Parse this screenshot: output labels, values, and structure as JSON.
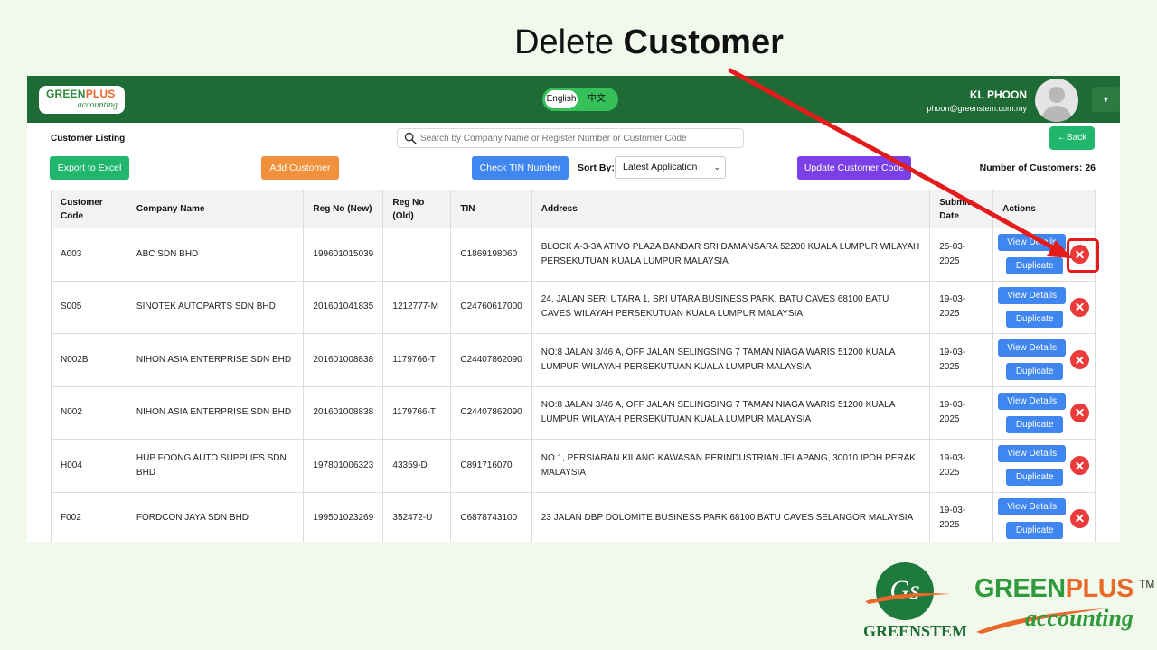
{
  "slide": {
    "title_light": "Delete",
    "title_bold": "Customer"
  },
  "header": {
    "logo_top_a": "GREEN",
    "logo_top_b": "PLUS",
    "logo_bottom": "accounting",
    "lang_en": "English",
    "lang_zh": "中文",
    "user_name": "KL PHOON",
    "user_email": "phoon@greenstem.com.my"
  },
  "page": {
    "title": "Customer Listing",
    "search_placeholder": "Search by Company Name or Register Number or Customer Code",
    "back_label": "←Back"
  },
  "toolbar": {
    "export_label": "Export to Excel",
    "add_label": "Add Customer",
    "check_tin_label": "Check TIN Number",
    "sort_label": "Sort By:",
    "sort_value": "Latest Application",
    "update_label": "Update Customer Code",
    "count_label": "Number of Customers: 26"
  },
  "table": {
    "headers": [
      "Customer Code",
      "Company Name",
      "Reg No (New)",
      "Reg No (Old)",
      "TIN",
      "Address",
      "Submit Date",
      "Actions"
    ],
    "view_label": "View Details",
    "duplicate_label": "Duplicate",
    "rows": [
      {
        "code": "A003",
        "company": "ABC SDN BHD",
        "reg_new": "199601015039",
        "reg_old": "",
        "tin": "C1869198060",
        "address": "BLOCK A-3-3A ATIVO PLAZA BANDAR SRI DAMANSARA 52200 KUALA LUMPUR WILAYAH PERSEKUTUAN KUALA LUMPUR MALAYSIA",
        "date": "25-03-2025"
      },
      {
        "code": "S005",
        "company": "SINOTEK AUTOPARTS SDN BHD",
        "reg_new": "201601041835",
        "reg_old": "1212777-M",
        "tin": "C24760617000",
        "address": "24, JALAN SERI UTARA 1, SRI UTARA BUSINESS PARK, BATU CAVES 68100 BATU CAVES WILAYAH PERSEKUTUAN KUALA LUMPUR MALAYSIA",
        "date": "19-03-2025"
      },
      {
        "code": "N002B",
        "company": "NIHON ASIA ENTERPRISE SDN BHD",
        "reg_new": "201601008838",
        "reg_old": "1179766-T",
        "tin": "C24407862090",
        "address": "NO:8 JALAN 3/46 A, OFF JALAN SELINGSING 7 TAMAN NIAGA WARIS 51200 KUALA LUMPUR WILAYAH PERSEKUTUAN KUALA LUMPUR MALAYSIA",
        "date": "19-03-2025"
      },
      {
        "code": "N002",
        "company": "NIHON ASIA ENTERPRISE SDN BHD",
        "reg_new": "201601008838",
        "reg_old": "1179766-T",
        "tin": "C24407862090",
        "address": "NO:8 JALAN 3/46 A, OFF JALAN SELINGSING 7 TAMAN NIAGA WARIS 51200 KUALA LUMPUR WILAYAH PERSEKUTUAN KUALA LUMPUR MALAYSIA",
        "date": "19-03-2025"
      },
      {
        "code": "H004",
        "company": "HUP FOONG AUTO SUPPLIES SDN BHD",
        "reg_new": "197801006323",
        "reg_old": "43359-D",
        "tin": "C891716070",
        "address": "NO 1, PERSIARAN KILANG KAWASAN PERINDUSTRIAN JELAPANG, 30010 IPOH PERAK MALAYSIA",
        "date": "19-03-2025"
      },
      {
        "code": "F002",
        "company": "FORDCON JAYA SDN BHD",
        "reg_new": "199501023269",
        "reg_old": "352472-U",
        "tin": "C6878743100",
        "address": "23 JALAN DBP DOLOMITE BUSINESS PARK 68100 BATU CAVES SELANGOR MALAYSIA",
        "date": "19-03-2025"
      }
    ]
  },
  "brand": {
    "gs_mark": "Gs",
    "gs_name": "GREENSTEM",
    "gp_a": "GREEN",
    "gp_b": "PLUS",
    "gp_tm": "TM",
    "gp_sub": "accounting"
  },
  "colors": {
    "header_green": "#1f6b35",
    "accent_red": "#e41b1b",
    "primary_blue": "#3f86f0"
  },
  "icons": [
    "search-icon",
    "delete-icon",
    "avatar-icon",
    "chevron-down-icon"
  ]
}
